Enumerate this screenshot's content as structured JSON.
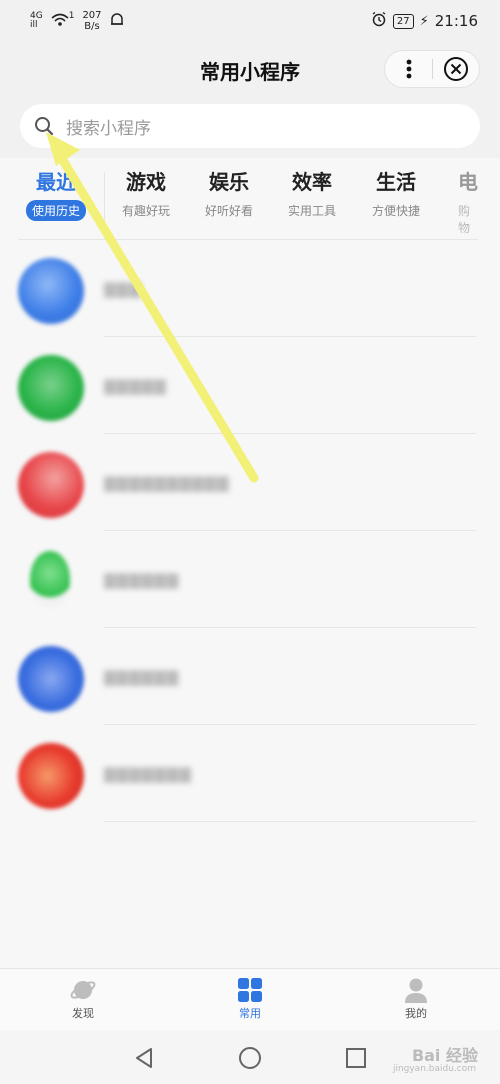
{
  "status_bar": {
    "network_top": "4G",
    "network_bottom": "ill",
    "sim": "1",
    "speed_value": "207",
    "speed_unit": "B/s",
    "battery": "27",
    "time": "21:16"
  },
  "header": {
    "title": "常用小程序"
  },
  "search": {
    "placeholder": "搜索小程序"
  },
  "tabs": [
    {
      "title": "最近",
      "subtitle": "使用历史",
      "active": true
    },
    {
      "title": "游戏",
      "subtitle": "有趣好玩",
      "active": false
    },
    {
      "title": "娱乐",
      "subtitle": "好听好看",
      "active": false
    },
    {
      "title": "效率",
      "subtitle": "实用工具",
      "active": false
    },
    {
      "title": "生活",
      "subtitle": "方便快捷",
      "active": false
    },
    {
      "title": "电",
      "subtitle": "购物",
      "active": false
    }
  ],
  "list": [
    {
      "label": "▇▇▇",
      "color": "#3f7fe8"
    },
    {
      "label": "▇▇▇▇▇",
      "color": "#2bb54a"
    },
    {
      "label": "▇▇▇▇▇▇▇▇▇▇",
      "color": "#e8464a"
    },
    {
      "label": "▇▇▇▇▇▇",
      "color": "#2fbf4c"
    },
    {
      "label": "▇▇▇▇▇▇",
      "color": "#3a6ee0"
    },
    {
      "label": "▇▇▇▇▇▇▇",
      "color": "#e83b2e"
    }
  ],
  "tabbar": {
    "discover_label": "发现",
    "common_label": "常用",
    "mine_label": "我的"
  },
  "watermark": {
    "text": "Bai 经验",
    "sub": "jingyan.baidu.com"
  },
  "colors": {
    "accent": "#2f76e0",
    "annotation_arrow": "#f3f078"
  }
}
